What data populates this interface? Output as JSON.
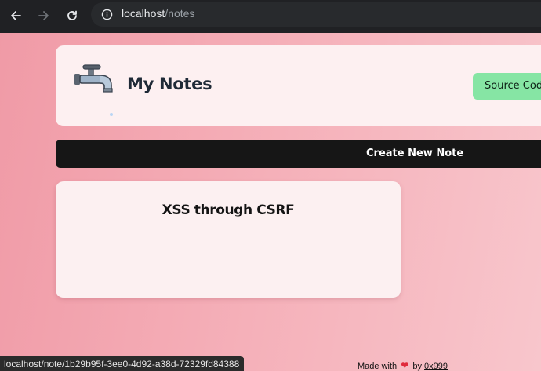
{
  "browser": {
    "url_host": "localhost",
    "url_path": "/notes"
  },
  "header": {
    "title": "My Notes",
    "source_button": "Source Code"
  },
  "actions": {
    "create_note": "Create New Note"
  },
  "notes": [
    {
      "title": "XSS through CSRF"
    }
  ],
  "status_bar": {
    "link_url": "localhost/note/1b29b95f-3ee0-4d92-a38d-72329fd84388"
  },
  "footer": {
    "made_with": "Made with",
    "heart_icon": "heart-icon",
    "by": "by",
    "author": "0x999"
  },
  "colors": {
    "chrome_bg": "#202124",
    "source_button_bg": "#86e5a4",
    "create_bar_bg": "#161616",
    "card_bg": "#fdf0f1",
    "heart": "#e02a3c"
  }
}
